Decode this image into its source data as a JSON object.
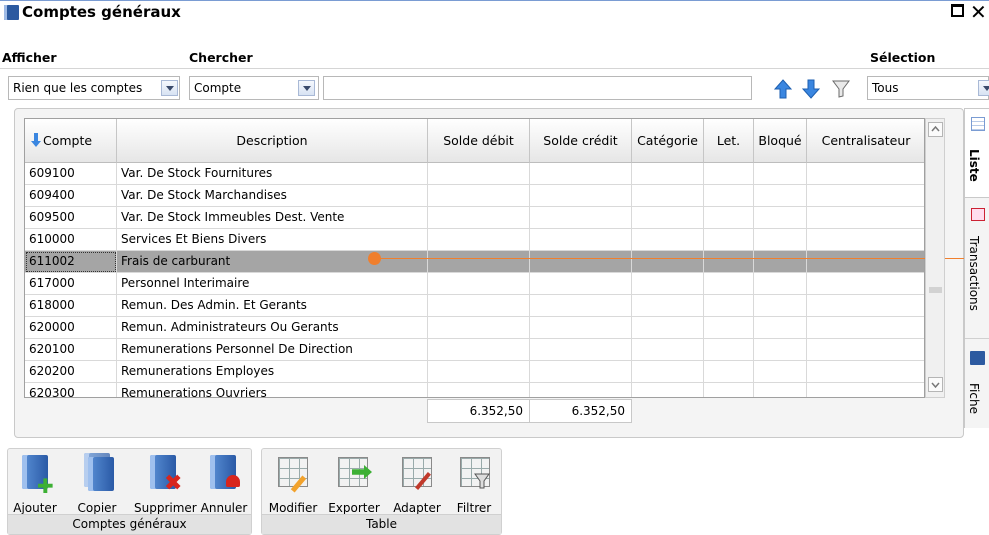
{
  "window": {
    "title": "Comptes généraux"
  },
  "labels": {
    "afficher": "Afficher",
    "chercher": "Chercher",
    "selection": "Sélection"
  },
  "filters": {
    "afficher_value": "Rien que les comptes",
    "chercher_value": "Compte",
    "search_value": "",
    "selection_value": "Tous"
  },
  "columns": [
    "Compte",
    "Description",
    "Solde débit",
    "Solde crédit",
    "Catégorie",
    "Let.",
    "Bloqué",
    "Centralisateur"
  ],
  "rows": [
    {
      "compte": "609100",
      "description": "Var. De Stock Fournitures"
    },
    {
      "compte": "609400",
      "description": "Var. De Stock Marchandises"
    },
    {
      "compte": "609500",
      "description": "Var. De Stock Immeubles Dest. Vente"
    },
    {
      "compte": "610000",
      "description": "Services Et Biens Divers"
    },
    {
      "compte": "611002",
      "description": "Frais de carburant"
    },
    {
      "compte": "617000",
      "description": "Personnel Interimaire"
    },
    {
      "compte": "618000",
      "description": "Remun. Des Admin. Et Gerants"
    },
    {
      "compte": "620000",
      "description": "Remun. Administrateurs Ou Gerants"
    },
    {
      "compte": "620100",
      "description": "Remunerations Personnel De Direction"
    },
    {
      "compte": "620200",
      "description": "Remunerations  Employes"
    },
    {
      "compte": "620300",
      "description": "Remunerations  Ouvriers"
    }
  ],
  "totals": {
    "debit": "6.352,50",
    "credit": "6.352,50"
  },
  "side_tabs": [
    "Liste",
    "Transactions",
    "Fiche"
  ],
  "toolbar": {
    "group1": {
      "caption": "Comptes généraux",
      "buttons": [
        "Ajouter",
        "Copier",
        "Supprimer",
        "Annuler"
      ]
    },
    "group2": {
      "caption": "Table",
      "buttons": [
        "Modifier",
        "Exporter",
        "Adapter",
        "Filtrer"
      ]
    }
  },
  "colors": {
    "selected_row": "#a5a5a5",
    "accent": "#2c5aa0",
    "marker": "#f07f2d"
  }
}
